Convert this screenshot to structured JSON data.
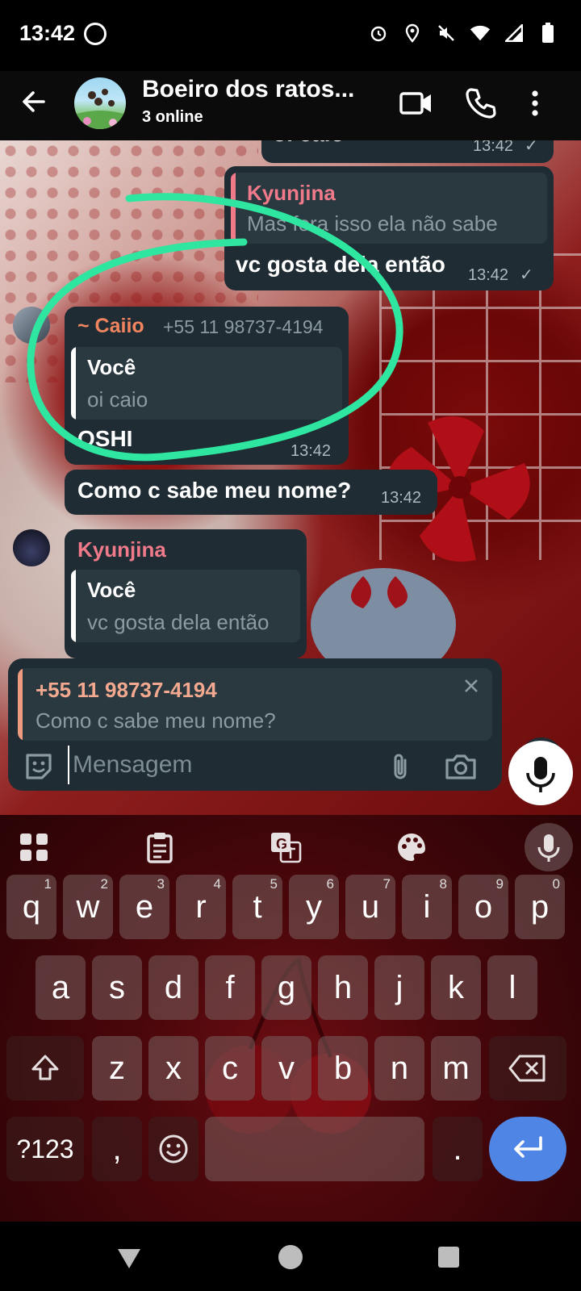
{
  "status_bar": {
    "time": "13:42",
    "app_icon": "whatsapp-icon",
    "right_icons": [
      "alarm-icon",
      "location-icon",
      "mute-icon",
      "wifi-icon",
      "signal-icon",
      "battery-icon"
    ]
  },
  "header": {
    "group_name": "Boeiro dos ratos...",
    "status": "3 online",
    "icons": [
      "back-arrow-icon",
      "video-call-icon",
      "phone-icon",
      "more-vert-icon"
    ]
  },
  "messages": [
    {
      "id": "m1",
      "text": "oi caio",
      "time": "13:42",
      "outgoing": true,
      "tick": "✓"
    },
    {
      "id": "m2",
      "quote_name": "Kyunjina",
      "quote_text": "Mas fora isso ela não sabe",
      "text": "vc gosta dela então",
      "time": "13:42",
      "outgoing": true,
      "tick": "✓"
    },
    {
      "id": "m3",
      "sender": "~ Caiio",
      "sender_phone": "+55 11 98737-4194",
      "quote_name": "Você",
      "quote_text": "oi caio",
      "text": "OSHI",
      "time": "13:42",
      "outgoing": false
    },
    {
      "id": "m4",
      "text": "Como c sabe meu nome?",
      "time": "13:42",
      "outgoing": false
    },
    {
      "id": "m5",
      "sender": "Kyunjina",
      "quote_name": "Você",
      "quote_text": "vc gosta dela então",
      "outgoing": false
    }
  ],
  "composer": {
    "reply_name": "+55 11 98737-4194",
    "reply_text": "Como c sabe meu nome?",
    "placeholder": "Mensagem"
  },
  "keyboard": {
    "row1": [
      [
        "q",
        "1"
      ],
      [
        "w",
        "2"
      ],
      [
        "e",
        "3"
      ],
      [
        "r",
        "4"
      ],
      [
        "t",
        "5"
      ],
      [
        "y",
        "6"
      ],
      [
        "u",
        "7"
      ],
      [
        "i",
        "8"
      ],
      [
        "o",
        "9"
      ],
      [
        "p",
        "0"
      ]
    ],
    "row2": [
      "a",
      "s",
      "d",
      "f",
      "g",
      "h",
      "j",
      "k",
      "l"
    ],
    "row3": [
      "z",
      "x",
      "c",
      "v",
      "b",
      "n",
      "m"
    ],
    "symbols_key": "?123",
    "comma_key": ",",
    "period_key": "."
  },
  "colors": {
    "bubble": "#1f2c33",
    "caiio_name": "#f0855f",
    "kyunjina_name": "#f07a8a",
    "annotation_green": "#2ee6a0",
    "enter_key": "#4f86e6"
  }
}
